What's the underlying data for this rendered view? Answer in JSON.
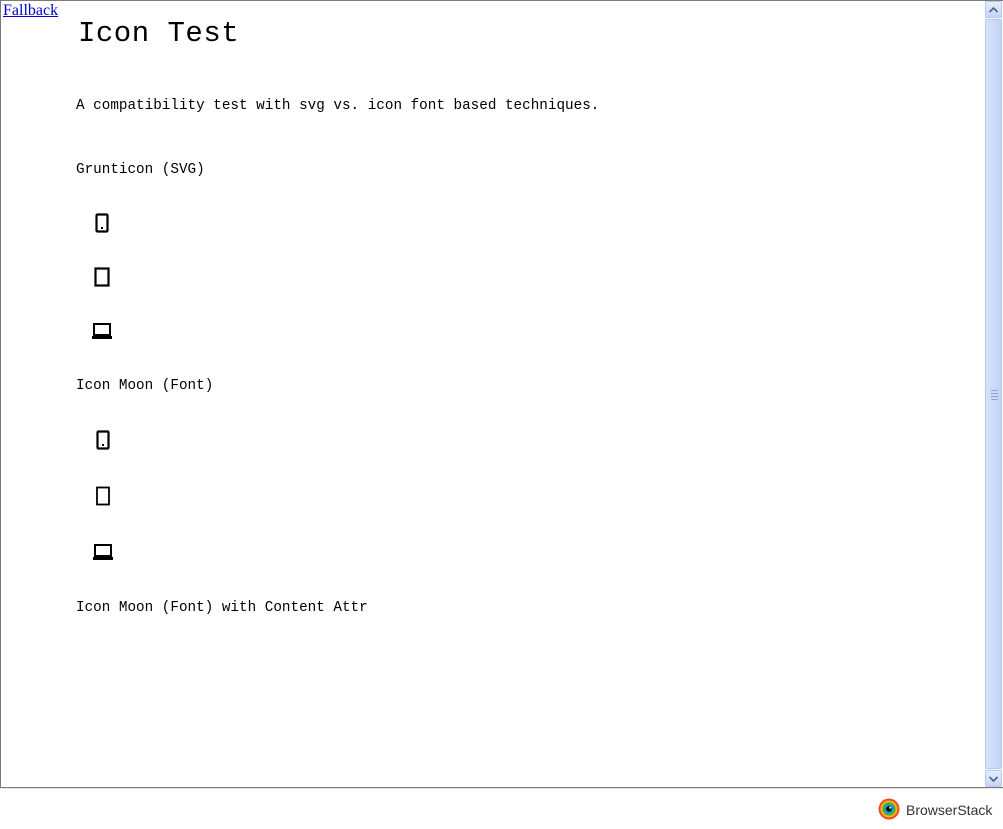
{
  "page": {
    "fallback_link": "Fallback",
    "title": "Icon Test",
    "lead": "A compatibility test with svg vs. icon font based techniques."
  },
  "sections": [
    {
      "heading": "Grunticon (SVG)",
      "icons": [
        "phone-icon",
        "tablet-icon",
        "laptop-icon"
      ]
    },
    {
      "heading": "Icon Moon (Font)",
      "icons": [
        "phone-icon",
        "tablet-icon",
        "laptop-icon"
      ]
    },
    {
      "heading": "Icon Moon (Font) with Content Attr",
      "icons": []
    }
  ],
  "statusbar": {
    "brand": "BrowserStack"
  },
  "colors": {
    "link": "#0000cc",
    "scrollbar": "#c5d5f5"
  }
}
